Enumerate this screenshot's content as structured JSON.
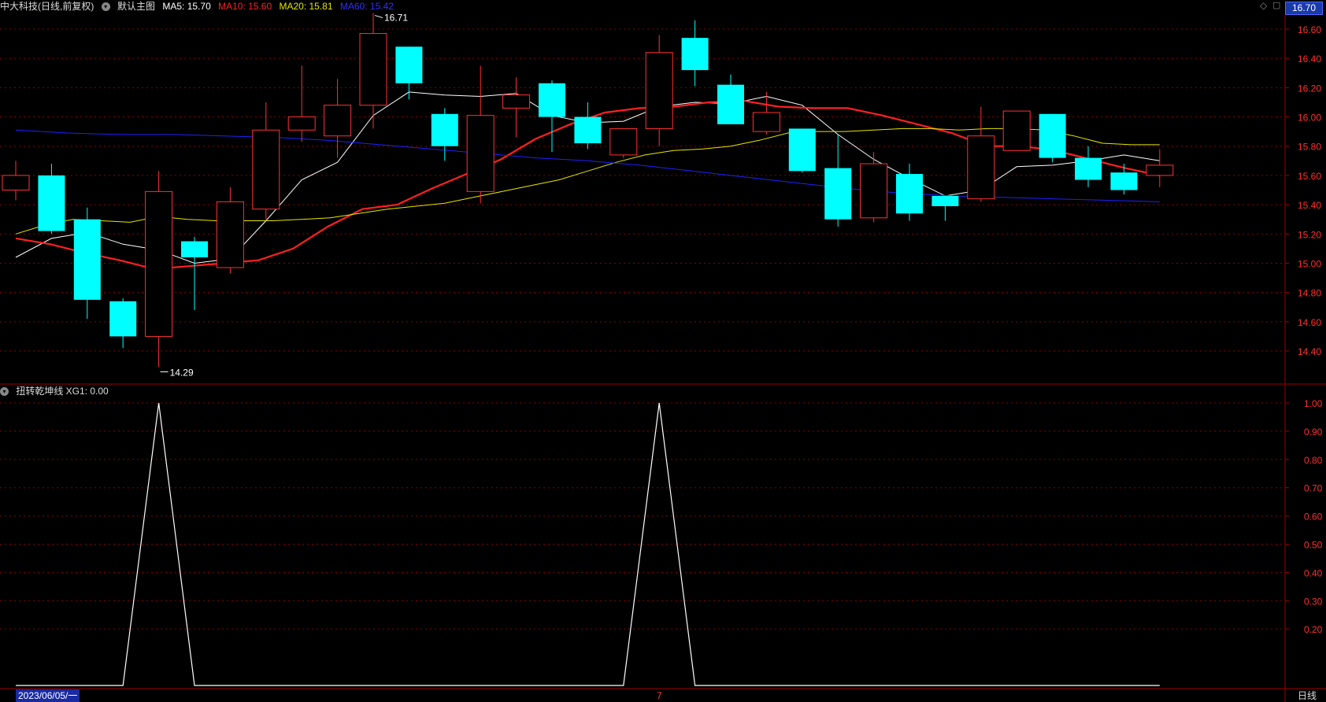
{
  "header": {
    "stock_label": "中大科技(日线,前复权)",
    "main_label": "默认主图",
    "ma5": "MA5: 15.70",
    "ma10": "MA10: 15.60",
    "ma20": "MA20: 15.81",
    "ma60": "MA60: 15.42",
    "current_price": "16.70",
    "icons": [
      "diamond-icon",
      "square-icon"
    ]
  },
  "indicator_header": {
    "label": "扭转乾坤线 XG1: 0.00"
  },
  "footer": {
    "date": "2023/06/05/一",
    "mid_mark": "7",
    "period": "日线"
  },
  "colors": {
    "up": "#ff3232",
    "down": "#00ffff",
    "ma5": "#ffffff",
    "ma10": "#ff2020",
    "ma20": "#e6e600",
    "ma60": "#2020ff",
    "grid": "#8b0000",
    "xg1": "#ffffff"
  },
  "chart_data": [
    {
      "type": "candlestick",
      "title": "中大科技(日线,前复权)",
      "ylim": [
        14.2,
        16.75
      ],
      "y_ticks": [
        "16.60",
        "16.40",
        "16.20",
        "16.00",
        "15.80",
        "15.60",
        "15.40",
        "15.20",
        "15.00",
        "14.80",
        "14.60",
        "14.40"
      ],
      "annotations": {
        "high": "16.71",
        "low": "14.29"
      },
      "candles": [
        {
          "o": 15.5,
          "c": 15.6,
          "h": 15.7,
          "l": 15.43
        },
        {
          "o": 15.6,
          "c": 15.22,
          "h": 15.68,
          "l": 15.2
        },
        {
          "o": 15.3,
          "c": 14.75,
          "h": 15.38,
          "l": 14.62
        },
        {
          "o": 14.74,
          "c": 14.5,
          "h": 14.76,
          "l": 14.42
        },
        {
          "o": 14.5,
          "c": 15.49,
          "h": 15.63,
          "l": 14.29
        },
        {
          "o": 15.15,
          "c": 15.04,
          "h": 15.18,
          "l": 14.68
        },
        {
          "o": 14.97,
          "c": 15.42,
          "h": 15.52,
          "l": 14.93
        },
        {
          "o": 15.37,
          "c": 15.91,
          "h": 16.1,
          "l": 15.3
        },
        {
          "o": 15.91,
          "c": 16.0,
          "h": 16.35,
          "l": 15.83
        },
        {
          "o": 15.87,
          "c": 16.08,
          "h": 16.26,
          "l": 15.72
        },
        {
          "o": 16.08,
          "c": 16.57,
          "h": 16.71,
          "l": 15.92
        },
        {
          "o": 16.48,
          "c": 16.23,
          "h": 16.48,
          "l": 16.12
        },
        {
          "o": 16.02,
          "c": 15.8,
          "h": 16.06,
          "l": 15.7
        },
        {
          "o": 15.49,
          "c": 16.01,
          "h": 16.35,
          "l": 15.41
        },
        {
          "o": 16.06,
          "c": 16.15,
          "h": 16.27,
          "l": 15.86
        },
        {
          "o": 16.23,
          "c": 16.0,
          "h": 16.25,
          "l": 15.76
        },
        {
          "o": 16.0,
          "c": 15.82,
          "h": 16.1,
          "l": 15.78
        },
        {
          "o": 15.74,
          "c": 15.92,
          "h": 15.92,
          "l": 15.72
        },
        {
          "o": 15.92,
          "c": 16.44,
          "h": 16.56,
          "l": 15.8
        },
        {
          "o": 16.54,
          "c": 16.32,
          "h": 16.66,
          "l": 16.21
        },
        {
          "o": 16.22,
          "c": 15.95,
          "h": 16.29,
          "l": 15.95
        },
        {
          "o": 15.9,
          "c": 16.03,
          "h": 16.17,
          "l": 15.88
        },
        {
          "o": 15.92,
          "c": 15.63,
          "h": 15.92,
          "l": 15.62
        },
        {
          "o": 15.65,
          "c": 15.3,
          "h": 15.88,
          "l": 15.25
        },
        {
          "o": 15.31,
          "c": 15.68,
          "h": 15.76,
          "l": 15.28
        },
        {
          "o": 15.61,
          "c": 15.34,
          "h": 15.68,
          "l": 15.29
        },
        {
          "o": 15.46,
          "c": 15.39,
          "h": 15.46,
          "l": 15.29
        },
        {
          "o": 15.44,
          "c": 15.87,
          "h": 16.07,
          "l": 15.42
        },
        {
          "o": 15.77,
          "c": 16.04,
          "h": 16.04,
          "l": 15.77
        },
        {
          "o": 16.02,
          "c": 15.72,
          "h": 16.02,
          "l": 15.69
        },
        {
          "o": 15.72,
          "c": 15.57,
          "h": 15.8,
          "l": 15.52
        },
        {
          "o": 15.62,
          "c": 15.5,
          "h": 15.68,
          "l": 15.47
        },
        {
          "o": 15.6,
          "c": 15.67,
          "h": 15.78,
          "l": 15.52
        }
      ],
      "series": [
        {
          "name": "MA5",
          "values": [
            15.04,
            15.17,
            15.21,
            15.13,
            15.09,
            15.0,
            15.03,
            15.29,
            15.57,
            15.69,
            16.01,
            16.17,
            16.15,
            16.14,
            16.16,
            16.01,
            15.96,
            15.97,
            16.07,
            16.1,
            16.09,
            16.14,
            16.08,
            15.88,
            15.71,
            15.58,
            15.46,
            15.5,
            15.66,
            15.67,
            15.7,
            15.74,
            15.7
          ]
        },
        {
          "name": "MA10",
          "values": [
            15.17,
            15.13,
            15.07,
            15.02,
            14.96,
            14.98,
            15.0,
            15.02,
            15.1,
            15.25,
            15.37,
            15.4,
            15.51,
            15.61,
            15.71,
            15.85,
            15.95,
            16.03,
            16.06,
            16.07,
            16.1,
            16.11,
            16.07,
            16.06,
            16.06,
            16.01,
            15.95,
            15.89,
            15.8,
            15.8,
            15.77,
            15.71,
            15.65,
            15.6
          ]
        },
        {
          "name": "MA20",
          "values": [
            15.2,
            15.26,
            15.3,
            15.29,
            15.28,
            15.32,
            15.3,
            15.29,
            15.29,
            15.29,
            15.3,
            15.31,
            15.34,
            15.37,
            15.39,
            15.41,
            15.45,
            15.49,
            15.53,
            15.57,
            15.63,
            15.69,
            15.74,
            15.77,
            15.78,
            15.8,
            15.84,
            15.89,
            15.9,
            15.9,
            15.91,
            15.92,
            15.92,
            15.91,
            15.92,
            15.92,
            15.91,
            15.87,
            15.82,
            15.81,
            15.81
          ]
        },
        {
          "name": "MA60",
          "values": [
            15.91,
            15.89,
            15.88,
            15.88,
            15.87,
            15.86,
            15.84,
            15.81,
            15.78,
            15.75,
            15.72,
            15.7,
            15.67,
            15.63,
            15.59,
            15.55,
            15.51,
            15.48,
            15.46,
            15.45,
            15.44,
            15.43,
            15.42
          ]
        }
      ]
    },
    {
      "type": "line",
      "title": "扭转乾坤线",
      "ylim": [
        0,
        1.05
      ],
      "y_ticks": [
        "1.00",
        "0.90",
        "0.80",
        "0.70",
        "0.60",
        "0.50",
        "0.40",
        "0.30",
        "0.20"
      ],
      "series": [
        {
          "name": "XG1",
          "values": [
            0,
            0,
            0,
            0,
            1,
            0,
            0,
            0,
            0,
            0,
            0,
            0,
            0,
            0,
            0,
            0,
            0,
            0,
            1,
            0,
            0,
            0,
            0,
            0,
            0,
            0,
            0,
            0,
            0,
            0,
            0,
            0,
            0
          ]
        }
      ]
    }
  ]
}
